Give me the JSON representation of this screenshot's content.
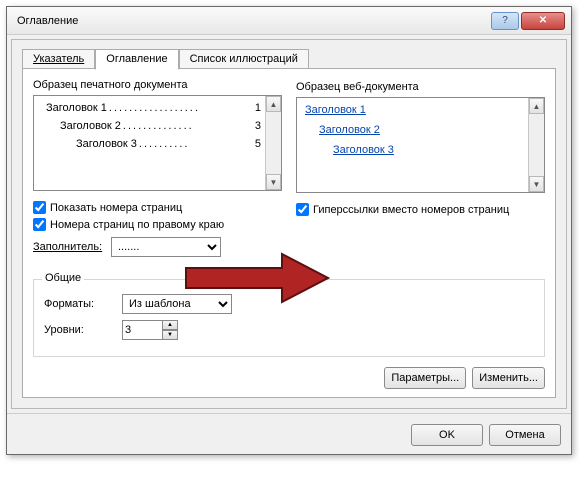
{
  "window": {
    "title": "Оглавление"
  },
  "tabs": {
    "index": "Указатель",
    "toc": "Оглавление",
    "figures": "Список иллюстраций"
  },
  "print_preview": {
    "label": "Образец печатного документа",
    "rows": [
      {
        "text": "Заголовок 1",
        "page": "1"
      },
      {
        "text": "Заголовок 2",
        "page": "3"
      },
      {
        "text": "Заголовок 3",
        "page": "5"
      }
    ]
  },
  "web_preview": {
    "label": "Образец веб-документа",
    "links": [
      "Заголовок 1",
      "Заголовок 2",
      "Заголовок 3"
    ]
  },
  "options": {
    "show_page_numbers": "Показать номера страниц",
    "right_align_numbers": "Номера страниц по правому краю",
    "hyperlinks_instead": "Гиперссылки вместо номеров страниц",
    "tab_leader_label": "Заполнитель:",
    "tab_leader_value": ".......",
    "general_group": "Общие",
    "formats_label": "Форматы:",
    "formats_value": "Из шаблона",
    "levels_label": "Уровни:",
    "levels_value": "3"
  },
  "buttons": {
    "parameters": "Параметры...",
    "modify": "Изменить...",
    "ok": "OK",
    "cancel": "Отмена"
  },
  "colors": {
    "arrow": "#b02424"
  }
}
